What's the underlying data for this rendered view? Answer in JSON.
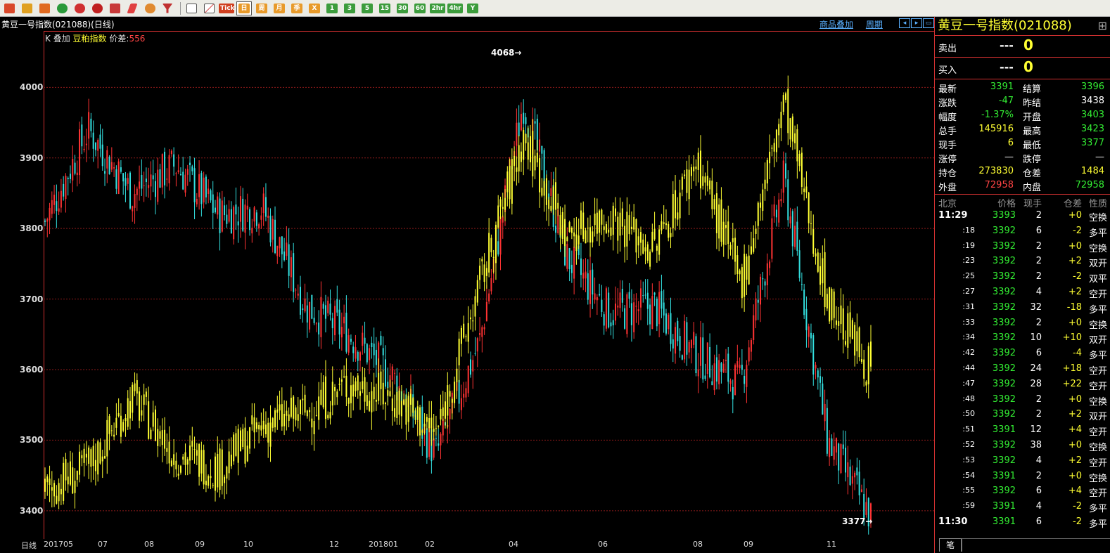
{
  "toolbar": {
    "icons": [
      "home-icon",
      "book-icon",
      "news-icon",
      "refresh-icon",
      "zoom-in-icon",
      "zoom-out-icon",
      "window-icon",
      "pen-icon",
      "palette-icon",
      "filter-icon",
      "grid-icon",
      "chart-icon"
    ],
    "periods": [
      "Tick",
      "日",
      "周",
      "月",
      "季",
      "X",
      "1",
      "3",
      "5",
      "15",
      "30",
      "60",
      "2hr",
      "4hr",
      "Y"
    ],
    "active_period": "日"
  },
  "chart": {
    "title": "黄豆一号指数(021088)(日线)",
    "overlay_prefix": "K",
    "overlay_label": "叠加",
    "overlay_symbol": "豆粕指数",
    "spread_label": "价差:",
    "spread_value": "556",
    "links": [
      "商品叠加",
      "周期"
    ],
    "high_label": "4068",
    "low_label": "3377",
    "period_label": "日线",
    "y_ticks": [
      "4000",
      "3900",
      "3800",
      "3700",
      "3600",
      "3500",
      "3400"
    ],
    "x_ticks": [
      "201705",
      "07",
      "08",
      "09",
      "10",
      "12",
      "201801",
      "02",
      "04",
      "06",
      "08",
      "09",
      "11"
    ]
  },
  "chart_data": {
    "type": "candlestick",
    "series": [
      {
        "name": "黄豆一号指数",
        "x": [
          "201705",
          "06",
          "07",
          "08",
          "09",
          "10",
          "11",
          "12",
          "201801",
          "02",
          "03",
          "04",
          "05",
          "06",
          "07",
          "08",
          "09",
          "10",
          "11",
          "11.28"
        ],
        "close": [
          3810,
          3940,
          3850,
          3890,
          3820,
          3830,
          3690,
          3650,
          3590,
          3480,
          3640,
          3980,
          3760,
          3680,
          3690,
          3620,
          3580,
          3870,
          3500,
          3391
        ]
      },
      {
        "name": "豆粕指数",
        "x": [
          "201705",
          "06",
          "07",
          "08",
          "09",
          "10",
          "11",
          "12",
          "201801",
          "02",
          "03",
          "04",
          "05",
          "06",
          "07",
          "08",
          "09",
          "10",
          "11",
          "11.28"
        ],
        "close": [
          3430,
          3460,
          3560,
          3480,
          3460,
          3520,
          3540,
          3580,
          3560,
          3510,
          3720,
          3930,
          3790,
          3820,
          3770,
          3900,
          3720,
          3980,
          3700,
          3600
        ]
      }
    ],
    "ylim": [
      3360,
      4080
    ],
    "high": 4068,
    "low": 3377
  },
  "panel": {
    "title": "黄豆一号指数(021088)",
    "sell_label": "卖出",
    "sell_price": "---",
    "sell_vol": "0",
    "buy_label": "买入",
    "buy_price": "---",
    "buy_vol": "0",
    "stats": [
      {
        "k1": "最新",
        "v1": "3391",
        "c1": "#33ee33",
        "k2": "结算",
        "v2": "3396",
        "c2": "#33ee33"
      },
      {
        "k1": "涨跌",
        "v1": "-47",
        "c1": "#33ee33",
        "k2": "昨结",
        "v2": "3438",
        "c2": "#ffffff"
      },
      {
        "k1": "幅度",
        "v1": "-1.37%",
        "c1": "#33ee33",
        "k2": "开盘",
        "v2": "3403",
        "c2": "#33ee33"
      },
      {
        "k1": "总手",
        "v1": "145916",
        "c1": "#ffff33",
        "k2": "最高",
        "v2": "3423",
        "c2": "#33ee33"
      },
      {
        "k1": "现手",
        "v1": "6",
        "c1": "#ffff33",
        "k2": "最低",
        "v2": "3377",
        "c2": "#33ee33"
      },
      {
        "k1": "涨停",
        "v1": "—",
        "c1": "#ffffff",
        "k2": "跌停",
        "v2": "—",
        "c2": "#ffffff"
      },
      {
        "k1": "持仓",
        "v1": "273830",
        "c1": "#ffff33",
        "k2": "仓差",
        "v2": "1484",
        "c2": "#ffff33"
      },
      {
        "k1": "外盘",
        "v1": "72958",
        "c1": "#ff4444",
        "k2": "内盘",
        "v2": "72958",
        "c2": "#33ee33"
      }
    ],
    "tick_header": [
      "北京",
      "价格",
      "现手",
      "仓差",
      "性质"
    ],
    "ticks": [
      {
        "t": "11:29",
        "p": "3393",
        "v": "2",
        "oi": "+0",
        "ty": "空换"
      },
      {
        "t": ":18",
        "p": "3392",
        "v": "6",
        "oi": "-2",
        "ty": "多平"
      },
      {
        "t": ":19",
        "p": "3392",
        "v": "2",
        "oi": "+0",
        "ty": "空换"
      },
      {
        "t": ":23",
        "p": "3392",
        "v": "2",
        "oi": "+2",
        "ty": "双开"
      },
      {
        "t": ":25",
        "p": "3392",
        "v": "2",
        "oi": "-2",
        "ty": "双平"
      },
      {
        "t": ":27",
        "p": "3392",
        "v": "4",
        "oi": "+2",
        "ty": "空开"
      },
      {
        "t": ":31",
        "p": "3392",
        "v": "32",
        "oi": "-18",
        "ty": "多平"
      },
      {
        "t": ":33",
        "p": "3392",
        "v": "2",
        "oi": "+0",
        "ty": "空换"
      },
      {
        "t": ":34",
        "p": "3392",
        "v": "10",
        "oi": "+10",
        "ty": "双开"
      },
      {
        "t": ":42",
        "p": "3392",
        "v": "6",
        "oi": "-4",
        "ty": "多平"
      },
      {
        "t": ":44",
        "p": "3392",
        "v": "24",
        "oi": "+18",
        "ty": "空开"
      },
      {
        "t": ":47",
        "p": "3392",
        "v": "28",
        "oi": "+22",
        "ty": "空开"
      },
      {
        "t": ":48",
        "p": "3392",
        "v": "2",
        "oi": "+0",
        "ty": "空换"
      },
      {
        "t": ":50",
        "p": "3392",
        "v": "2",
        "oi": "+2",
        "ty": "双开"
      },
      {
        "t": ":51",
        "p": "3391",
        "v": "12",
        "oi": "+4",
        "ty": "空开"
      },
      {
        "t": ":52",
        "p": "3392",
        "v": "38",
        "oi": "+0",
        "ty": "空换"
      },
      {
        "t": ":53",
        "p": "3392",
        "v": "4",
        "oi": "+2",
        "ty": "空开"
      },
      {
        "t": ":54",
        "p": "3391",
        "v": "2",
        "oi": "+0",
        "ty": "空换"
      },
      {
        "t": ":55",
        "p": "3392",
        "v": "6",
        "oi": "+4",
        "ty": "空开"
      },
      {
        "t": ":59",
        "p": "3391",
        "v": "4",
        "oi": "-2",
        "ty": "多平"
      },
      {
        "t": "11:30",
        "p": "3391",
        "v": "6",
        "oi": "-2",
        "ty": "多平"
      }
    ],
    "tab": "笔"
  },
  "colors": {
    "up": "#ff3333",
    "down": "#33e0e0",
    "overlay": "#ffff33",
    "grid": "#8b1a1a",
    "price": "#33ee33",
    "oi_pos": "#ffff33",
    "oi_neg": "#ffff33"
  }
}
